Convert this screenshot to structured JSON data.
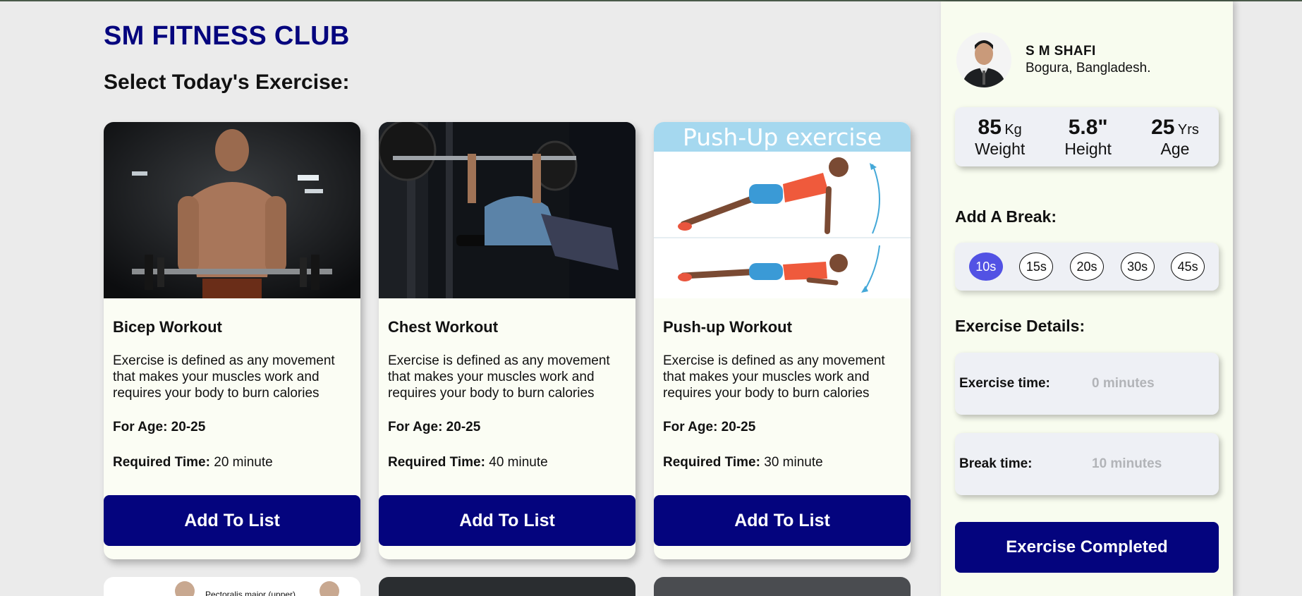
{
  "site": {
    "title": "SM FITNESS CLUB",
    "subtitle": "Select Today's Exercise:"
  },
  "exercises": [
    {
      "name": "Bicep Workout",
      "description": "Exercise is defined as any movement that makes your muscles work and requires your body to burn calories",
      "age_label": "For Age: 20-25",
      "time_label": "Required Time:",
      "time_value": " 20 minute",
      "button": "Add To List",
      "image": "bicep-curl-photo"
    },
    {
      "name": "Chest Workout",
      "description": "Exercise is defined as any movement that makes your muscles work and requires your body to burn calories",
      "age_label": "For Age: 20-25",
      "time_label": "Required Time:",
      "time_value": " 40 minute",
      "button": "Add To List",
      "image": "bench-press-photo"
    },
    {
      "name": "Push-up Workout",
      "description": "Exercise is defined as any movement that makes your muscles work and requires your body to burn calories",
      "age_label": "For Age: 20-25",
      "time_label": "Required Time:",
      "time_value": " 30 minute",
      "button": "Add To List",
      "image": "push-up-illustration",
      "image_caption": "Push-Up exercise"
    }
  ],
  "next_row_peek": {
    "first_caption": "Pectoralis major (upper)"
  },
  "profile": {
    "name": "S M SHAFI",
    "location": "Bogura, Bangladesh."
  },
  "stats": [
    {
      "value": "85",
      "unit": "Kg",
      "label": "Weight"
    },
    {
      "value": "5.8\"",
      "unit": "",
      "label": "Height"
    },
    {
      "value": "25",
      "unit": "Yrs",
      "label": "Age"
    }
  ],
  "breaks": {
    "heading": "Add A Break:",
    "options": [
      "10s",
      "15s",
      "20s",
      "30s",
      "45s"
    ],
    "selected": "10s",
    "selected_color": "#5252e4"
  },
  "details": {
    "heading": "Exercise Details:",
    "exercise_time_label": "Exercise time:",
    "exercise_time_value": "0 minutes",
    "break_time_label": "Break time:",
    "break_time_value": "10 minutes"
  },
  "complete_button": "Exercise Completed",
  "colors": {
    "brand": "#04047e",
    "card_bg": "#fbfdf4",
    "page_bg": "#ebebeb"
  }
}
